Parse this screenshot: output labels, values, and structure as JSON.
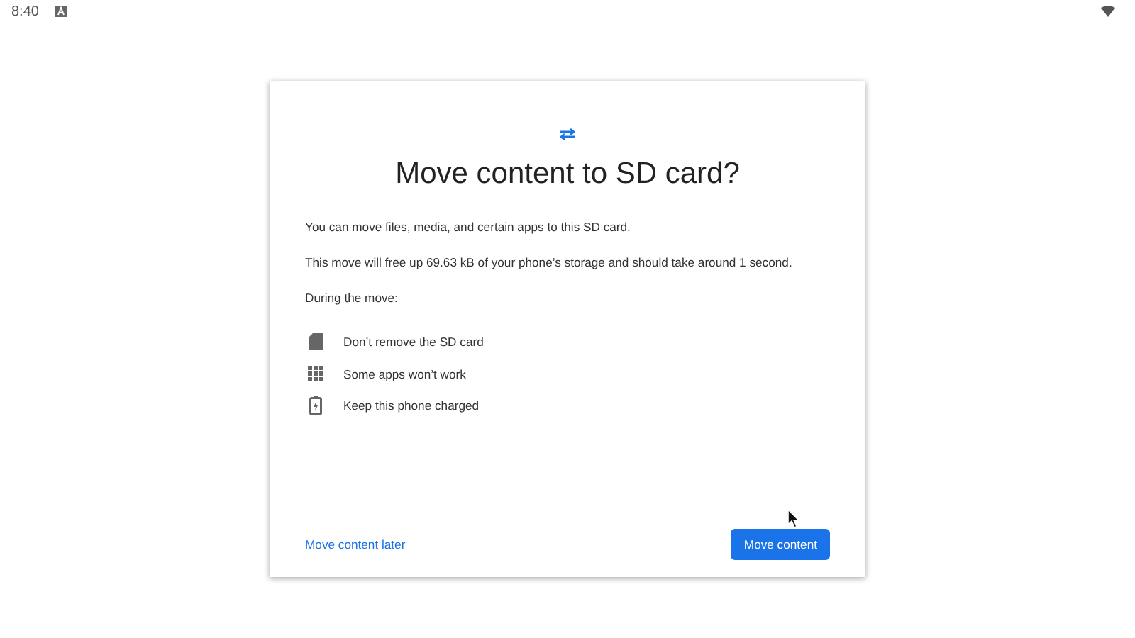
{
  "status_bar": {
    "time": "8:40"
  },
  "dialog": {
    "title": "Move content to SD card?",
    "paragraphs": [
      "You can move files, media, and certain apps to this SD card.",
      "This move will free up 69.63 kB of your phone’s storage and should take around 1 second.",
      "During the move:"
    ],
    "items": [
      {
        "kind": "sd",
        "label": "Don’t remove the SD card"
      },
      {
        "kind": "apps",
        "label": "Some apps won’t work"
      },
      {
        "kind": "battery",
        "label": "Keep this phone charged"
      }
    ],
    "secondary_action": "Move content later",
    "primary_action": "Move content"
  }
}
